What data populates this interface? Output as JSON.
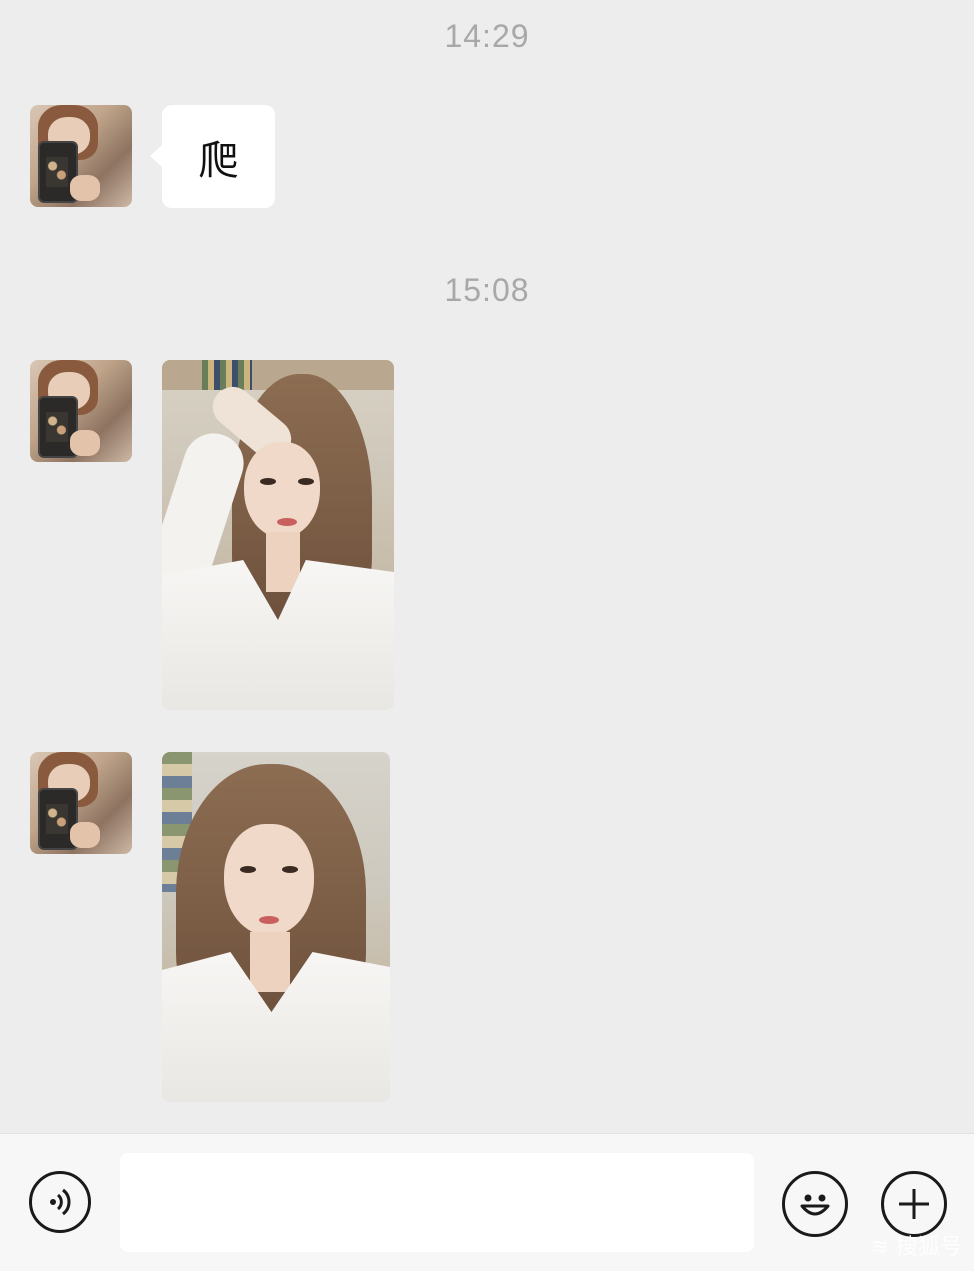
{
  "chat": {
    "timestamps": [
      "14:29",
      "15:08"
    ],
    "messages": [
      {
        "type": "text",
        "text": "爬"
      },
      {
        "type": "image",
        "description_icon": "photo-selfie-hand-on-head"
      },
      {
        "type": "image",
        "description_icon": "photo-selfie-portrait"
      }
    ]
  },
  "input_bar": {
    "voice_icon": "voice-icon",
    "text_value": "",
    "emoji_icon": "emoji-icon",
    "plus_icon": "plus-icon"
  },
  "watermark": "≋ 搜狐号"
}
